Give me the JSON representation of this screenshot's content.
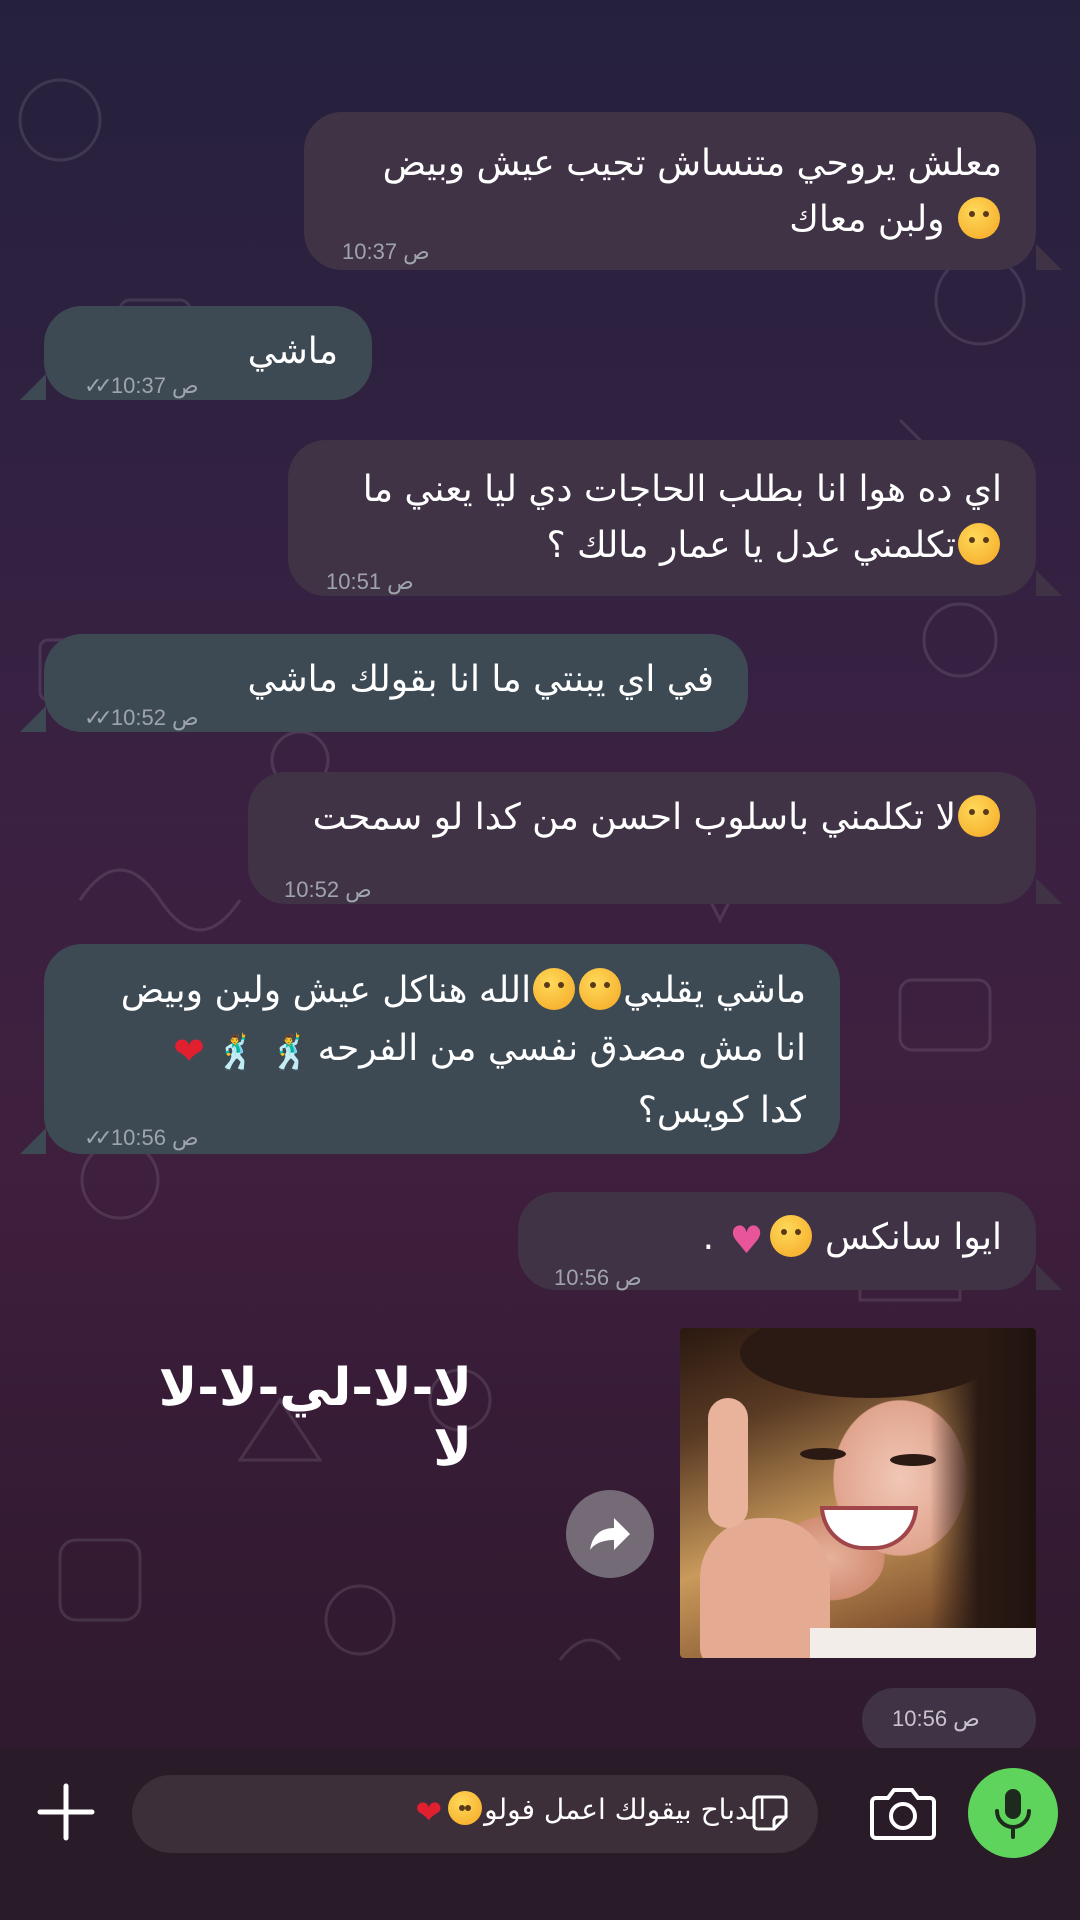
{
  "messages": [
    {
      "dir": "out",
      "lines": [
        "معلش يروحي متنساش تجيب عيش وبيض",
        "ولبن معاك"
      ],
      "time": "10:37 ص"
    },
    {
      "dir": "in",
      "lines": [
        "ماشي"
      ],
      "time": "10:37 ص"
    },
    {
      "dir": "out",
      "lines": [
        "اي ده هوا انا بطلب الحاجات دي ليا يعني ما",
        "تكلمني عدل يا عمار مالك ؟"
      ],
      "time": "10:51 ص"
    },
    {
      "dir": "in",
      "lines": [
        "في اي يبنتي ما انا بقولك ماشي"
      ],
      "time": "10:52 ص"
    },
    {
      "dir": "out",
      "lines": [
        "لا تكلمني باسلوب احسن من كدا لو سمحت"
      ],
      "time": "10:52 ص"
    },
    {
      "dir": "in",
      "lines": [
        "ماشي يقلبي",
        "الله هناكل عيش ولبن وبيض",
        "انا مش مصدق نفسي من الفرحه",
        "كدا كويس؟"
      ],
      "time": "10:56 ص"
    },
    {
      "dir": "out",
      "lines": [
        "ايوا سانكس",
        "."
      ],
      "time": "10:56 ص"
    }
  ],
  "media_message": {
    "overlay_text": "لا-لا-لي-لا-لا لا",
    "time": "10:56 ص"
  },
  "composer": {
    "draft_text": "الدباح بيقولك اعمل فولو"
  },
  "icons": {
    "plus": "plus-icon",
    "sticker": "sticker-icon",
    "camera": "camera-icon",
    "mic": "microphone-icon",
    "forward": "forward-arrow-icon",
    "read": "double-check-icon"
  },
  "colors": {
    "outgoing_bubble": "#3f3345",
    "incoming_bubble": "#3d4a54",
    "mic_button": "#5fd45c"
  }
}
